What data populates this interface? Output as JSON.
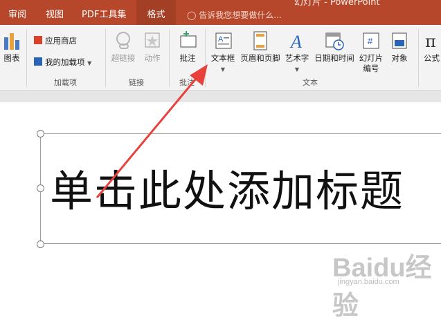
{
  "tabs": [
    "审阅",
    "视图",
    "PDF工具集",
    "格式"
  ],
  "tell_me": "告诉我您想要做什么...",
  "title_fragment": "幻灯片 - PowerPoint",
  "ribbon": {
    "chart_label": "图表",
    "addins": {
      "store": "应用商店",
      "my_addins": "我的加载项",
      "group": "加载项"
    },
    "links": {
      "hyperlink": "超链接",
      "action": "动作",
      "group": "链接"
    },
    "comments": {
      "comment": "批注",
      "group": "批注"
    },
    "text": {
      "textbox": "文本框",
      "header_footer": "页眉和页脚",
      "wordart": "艺术字",
      "datetime": "日期和时间",
      "slide_number_line1": "幻灯片",
      "slide_number_line2": "编号",
      "object": "对象",
      "group": "文本"
    },
    "symbols": {
      "formula": "公式"
    }
  },
  "slide": {
    "title_placeholder": "单击此处添加标题"
  },
  "watermark": {
    "logo": "Baidu经验",
    "url": "jingyan.baidu.com"
  },
  "colors": {
    "accent": "#b7472a",
    "arrow": "#e8413c"
  },
  "icons": [
    "chart-icon",
    "store-icon",
    "addin-icon",
    "hyperlink-icon",
    "action-icon",
    "comment-icon",
    "textbox-icon",
    "header-footer-icon",
    "wordart-icon",
    "datetime-icon",
    "slide-number-icon",
    "object-icon",
    "lightbulb-icon",
    "pi-icon"
  ]
}
